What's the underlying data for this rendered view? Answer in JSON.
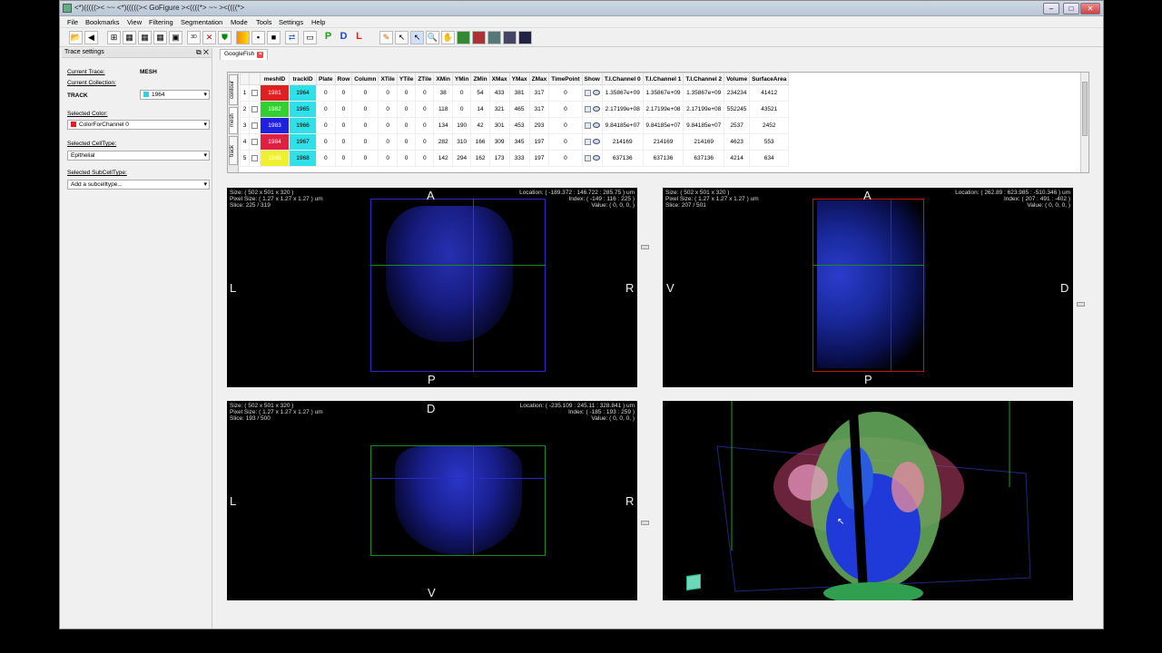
{
  "window": {
    "title": "<*)(((((>< ~~ <*)(((((>< GoFigure ><((((*> ~~ ><((((*>"
  },
  "menu": [
    "File",
    "Bookmarks",
    "View",
    "Filtering",
    "Segmentation",
    "Mode",
    "Tools",
    "Settings",
    "Help"
  ],
  "toolbar": {
    "letters": {
      "p": "P",
      "d": "D",
      "l": "L"
    },
    "colors": {
      "p": "#18a018",
      "d": "#2040e0",
      "l": "#e02020"
    }
  },
  "trace_settings": {
    "title": "Trace settings",
    "current_trace_label": "Current Trace:",
    "current_trace_value": "MESH",
    "current_collection_label": "Current Collection:",
    "collection_type": "TRACK",
    "collection_value": "1964",
    "collection_color": "#30d0e0",
    "selected_color_label": "Selected Color:",
    "selected_color_value": "ColorForChannel 0",
    "selected_color_swatch": "#e02020",
    "celltype_label": "Selected CellType:",
    "celltype_value": "Epithelial",
    "subcelltype_label": "Selected SubCellType:",
    "subcelltype_value": "Add a subcelltype..."
  },
  "tab": {
    "label": "GoogleFish"
  },
  "side_tabs": [
    "contour",
    "mesh",
    "track"
  ],
  "table": {
    "columns": [
      "meshID",
      "trackID",
      "Plate",
      "Row",
      "Column",
      "XTile",
      "YTile",
      "ZTile",
      "XMin",
      "YMin",
      "ZMin",
      "XMax",
      "YMax",
      "ZMax",
      "TimePoint",
      "Show",
      "T.I.Channel 0",
      "T.I.Channel 1",
      "T.I.Channel 2",
      "Volume",
      "SurfaceArea"
    ],
    "rows": [
      {
        "n": "1",
        "mesh": "1981",
        "mesh_color": "#e02020",
        "track": "1964",
        "track_color": "#30e0e8",
        "plate": "0",
        "row": "0",
        "column": "0",
        "xtile": "0",
        "ytile": "0",
        "ztile": "0",
        "xmin": "38",
        "ymin": "0",
        "zmin": "54",
        "xmax": "433",
        "ymax": "381",
        "zmax": "317",
        "tp": "0",
        "ch0": "1.35867e+09",
        "ch1": "1.35867e+09",
        "ch2": "1.35867e+09",
        "vol": "234234",
        "area": "41412"
      },
      {
        "n": "2",
        "mesh": "1982",
        "mesh_color": "#30d030",
        "track": "1965",
        "track_color": "#30e0e8",
        "plate": "0",
        "row": "0",
        "column": "0",
        "xtile": "0",
        "ytile": "0",
        "ztile": "0",
        "xmin": "118",
        "ymin": "0",
        "zmin": "14",
        "xmax": "321",
        "ymax": "465",
        "zmax": "317",
        "tp": "0",
        "ch0": "2.17199e+08",
        "ch1": "2.17199e+08",
        "ch2": "2.17199e+08",
        "vol": "552245",
        "area": "43521"
      },
      {
        "n": "3",
        "mesh": "1983",
        "mesh_color": "#2020e0",
        "track": "1966",
        "track_color": "#30e0e8",
        "plate": "0",
        "row": "0",
        "column": "0",
        "xtile": "0",
        "ytile": "0",
        "ztile": "0",
        "xmin": "134",
        "ymin": "190",
        "zmin": "42",
        "xmax": "301",
        "ymax": "453",
        "zmax": "293",
        "tp": "0",
        "ch0": "9.84185e+07",
        "ch1": "9.84185e+07",
        "ch2": "9.84185e+07",
        "vol": "2537",
        "area": "2452"
      },
      {
        "n": "4",
        "mesh": "1984",
        "mesh_color": "#e02040",
        "track": "1967",
        "track_color": "#30e0e8",
        "plate": "0",
        "row": "0",
        "column": "0",
        "xtile": "0",
        "ytile": "0",
        "ztile": "0",
        "xmin": "282",
        "ymin": "310",
        "zmin": "166",
        "xmax": "309",
        "ymax": "345",
        "zmax": "197",
        "tp": "0",
        "ch0": "214169",
        "ch1": "214169",
        "ch2": "214169",
        "vol": "4623",
        "area": "553"
      },
      {
        "n": "5",
        "mesh": "1985",
        "mesh_color": "#f0f030",
        "track": "1968",
        "track_color": "#30e0e8",
        "plate": "0",
        "row": "0",
        "column": "0",
        "xtile": "0",
        "ytile": "0",
        "ztile": "0",
        "xmin": "142",
        "ymin": "294",
        "zmin": "162",
        "xmax": "173",
        "ymax": "333",
        "zmax": "197",
        "tp": "0",
        "ch0": "637136",
        "ch1": "637136",
        "ch2": "637136",
        "vol": "4214",
        "area": "634"
      }
    ]
  },
  "views": {
    "v1": {
      "size": "Size: ( 502 x 501 x 320 )",
      "pixel": "Pixel Size: ( 1.27 x 1.27 x 1.27 ) um",
      "slice": "Slice: 225 / 319",
      "location": "Location: ( -189.372 : 146.722 : 285.75 ) um",
      "index": "Index: ( -149 : 116 : 225 )",
      "value": "Value: ( 0, 0, 0, )",
      "top": "A",
      "bottom": "P",
      "left": "L",
      "right": "R"
    },
    "v2": {
      "size": "Size: ( 502 x 501 x 320 )",
      "pixel": "Pixel Size: ( 1.27 x 1.27 x 1.27 ) um",
      "slice": "Slice: 207 / 501",
      "location": "Location: ( 262.89 : 623.985 : -510.346 ) um",
      "index": "Index: ( 207 : 491 : -402 )",
      "value": "Value: ( 0, 0, 0, )",
      "top": "A",
      "bottom": "P",
      "left": "V",
      "right": "D"
    },
    "v3": {
      "size": "Size: ( 502 x 501 x 320 )",
      "pixel": "Pixel Size: ( 1.27 x 1.27 x 1.27 ) um",
      "slice": "Slice: 193 / 500",
      "location": "Location: ( -235.109 : 245.11 : 328.841 ) um",
      "index": "Index: ( -185 : 193 : 259 )",
      "value": "Value: ( 0, 0, 0, )",
      "top": "D",
      "bottom": "V",
      "left": "L",
      "right": "R"
    }
  }
}
